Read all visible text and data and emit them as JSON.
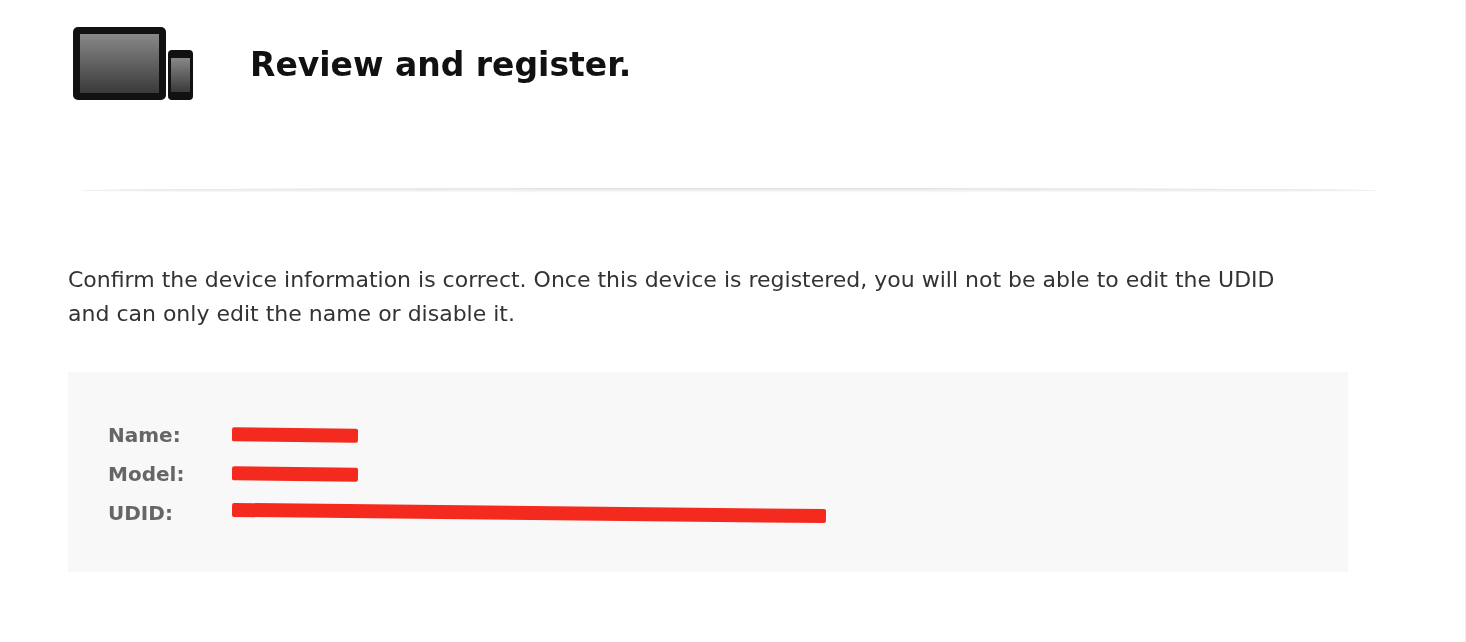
{
  "header": {
    "title": "Review and register."
  },
  "message": "Confirm the device information is correct. Once this device is registered, you will not be able to edit the UDID and can only edit the name or disable it.",
  "fields": [
    {
      "label": "Name:",
      "kind": "short"
    },
    {
      "label": "Model:",
      "kind": "short"
    },
    {
      "label": "UDID:",
      "kind": "long"
    }
  ]
}
